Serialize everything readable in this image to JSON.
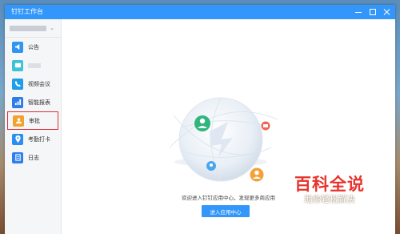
{
  "window": {
    "title": "钉钉工作台"
  },
  "sidebar": {
    "items": [
      {
        "label": "公告",
        "icon": "announcement-icon",
        "color": "#2f95f0"
      },
      {
        "label": "",
        "icon": "app-icon",
        "color": "#3fc2d6"
      },
      {
        "label": "视频会议",
        "icon": "video-call-icon",
        "color": "#1e9ee8"
      },
      {
        "label": "智能报表",
        "icon": "chart-icon",
        "color": "#2f7be8"
      },
      {
        "label": "审批",
        "icon": "approval-icon",
        "color": "#f2a12e"
      },
      {
        "label": "考勤打卡",
        "icon": "location-icon",
        "color": "#2d8ef0"
      },
      {
        "label": "日志",
        "icon": "log-icon",
        "color": "#2f7fee"
      }
    ]
  },
  "main": {
    "welcome_text": "欢迎进入钉钉应用中心，发现更多商应用",
    "enter_button": "进入应用中心"
  },
  "watermark": {
    "title": "百科全说",
    "subtitle": "助你轻松解决"
  },
  "colors": {
    "accent": "#3296fa",
    "highlight": "#e0303a"
  }
}
